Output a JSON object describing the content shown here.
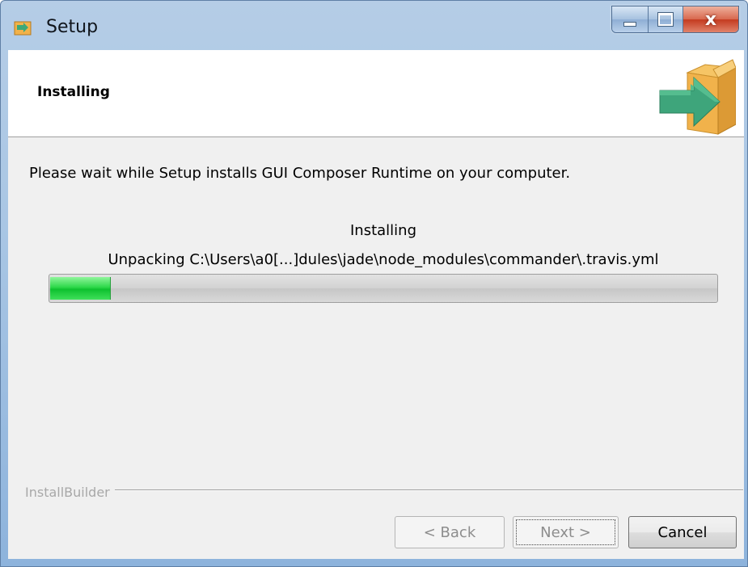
{
  "window": {
    "title": "Setup",
    "icon": "setup-app-icon",
    "controls": {
      "minimize": "minimize-icon",
      "maximize": "maximize-icon",
      "close": "x"
    }
  },
  "header": {
    "title": "Installing",
    "icon": "install-box-arrow-icon"
  },
  "main": {
    "description": "Please wait while Setup installs GUI Composer Runtime on your computer.",
    "status_title": "Installing",
    "status_detail": "Unpacking C:\\Users\\a0[...]dules\\jade\\node_modules\\commander\\.travis.yml",
    "progress_fraction": 0.09
  },
  "footer": {
    "brand": "InstallBuilder",
    "buttons": {
      "back": "< Back",
      "next": "Next >",
      "cancel": "Cancel"
    }
  },
  "colors": {
    "progress_green": "#1ed13d",
    "box_orange": "#f0b24a",
    "arrow_green": "#3daa7a"
  }
}
